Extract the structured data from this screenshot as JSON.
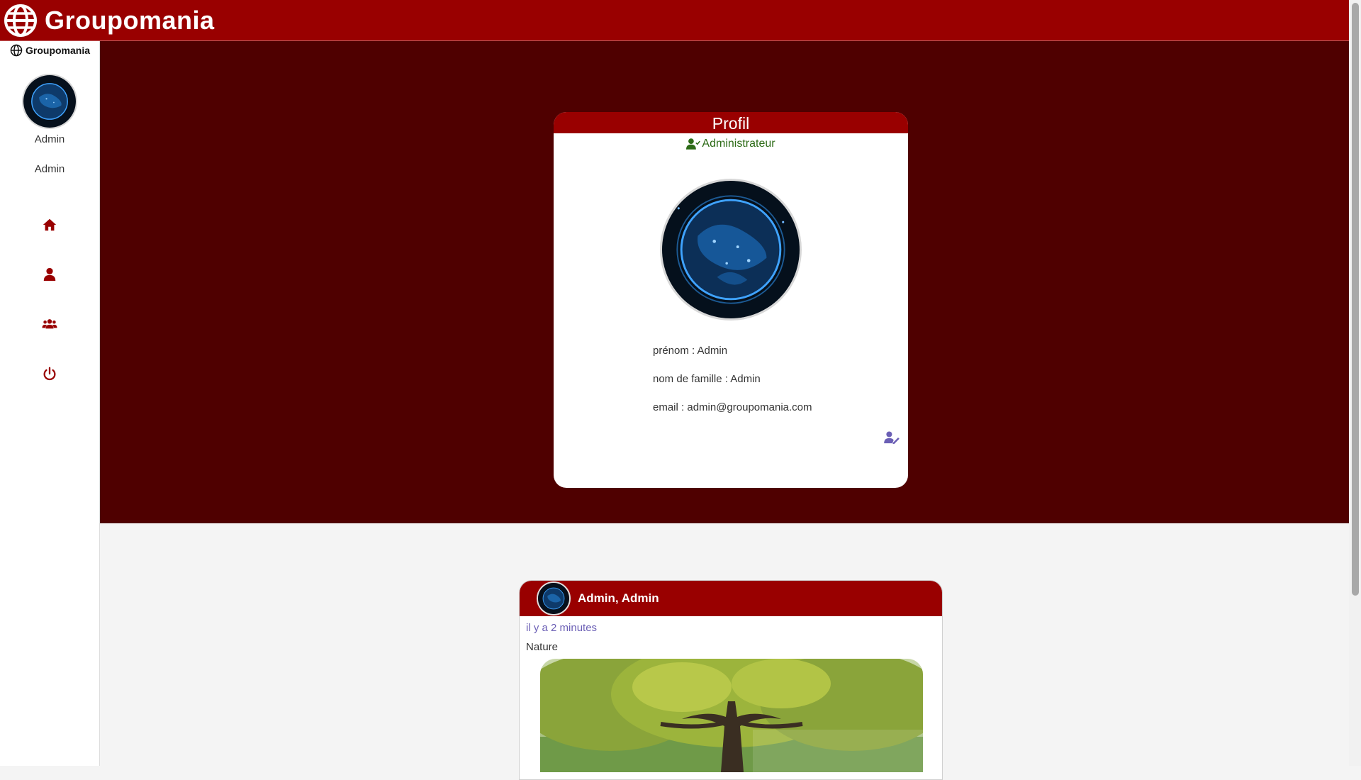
{
  "app": {
    "brand": "Groupomania"
  },
  "sidebar": {
    "brand": "Groupomania",
    "user_first": "Admin",
    "user_last": "Admin",
    "nav": [
      {
        "icon": "home-icon"
      },
      {
        "icon": "user-icon"
      },
      {
        "icon": "users-icon"
      },
      {
        "icon": "power-icon"
      }
    ]
  },
  "profile": {
    "title": "Profil",
    "role": "Administrateur",
    "firstname": "prénom : Admin",
    "lastname": "nom de famille : Admin",
    "email": "email : admin@groupomania.com"
  },
  "post": {
    "author": "Admin, Admin",
    "time": "il y a 2 minutes",
    "text": "Nature"
  },
  "colors": {
    "brand_red": "#990000",
    "hero_dark": "#4f0000",
    "role_green": "#2d6b17",
    "time_purple": "#6b5fb5"
  }
}
